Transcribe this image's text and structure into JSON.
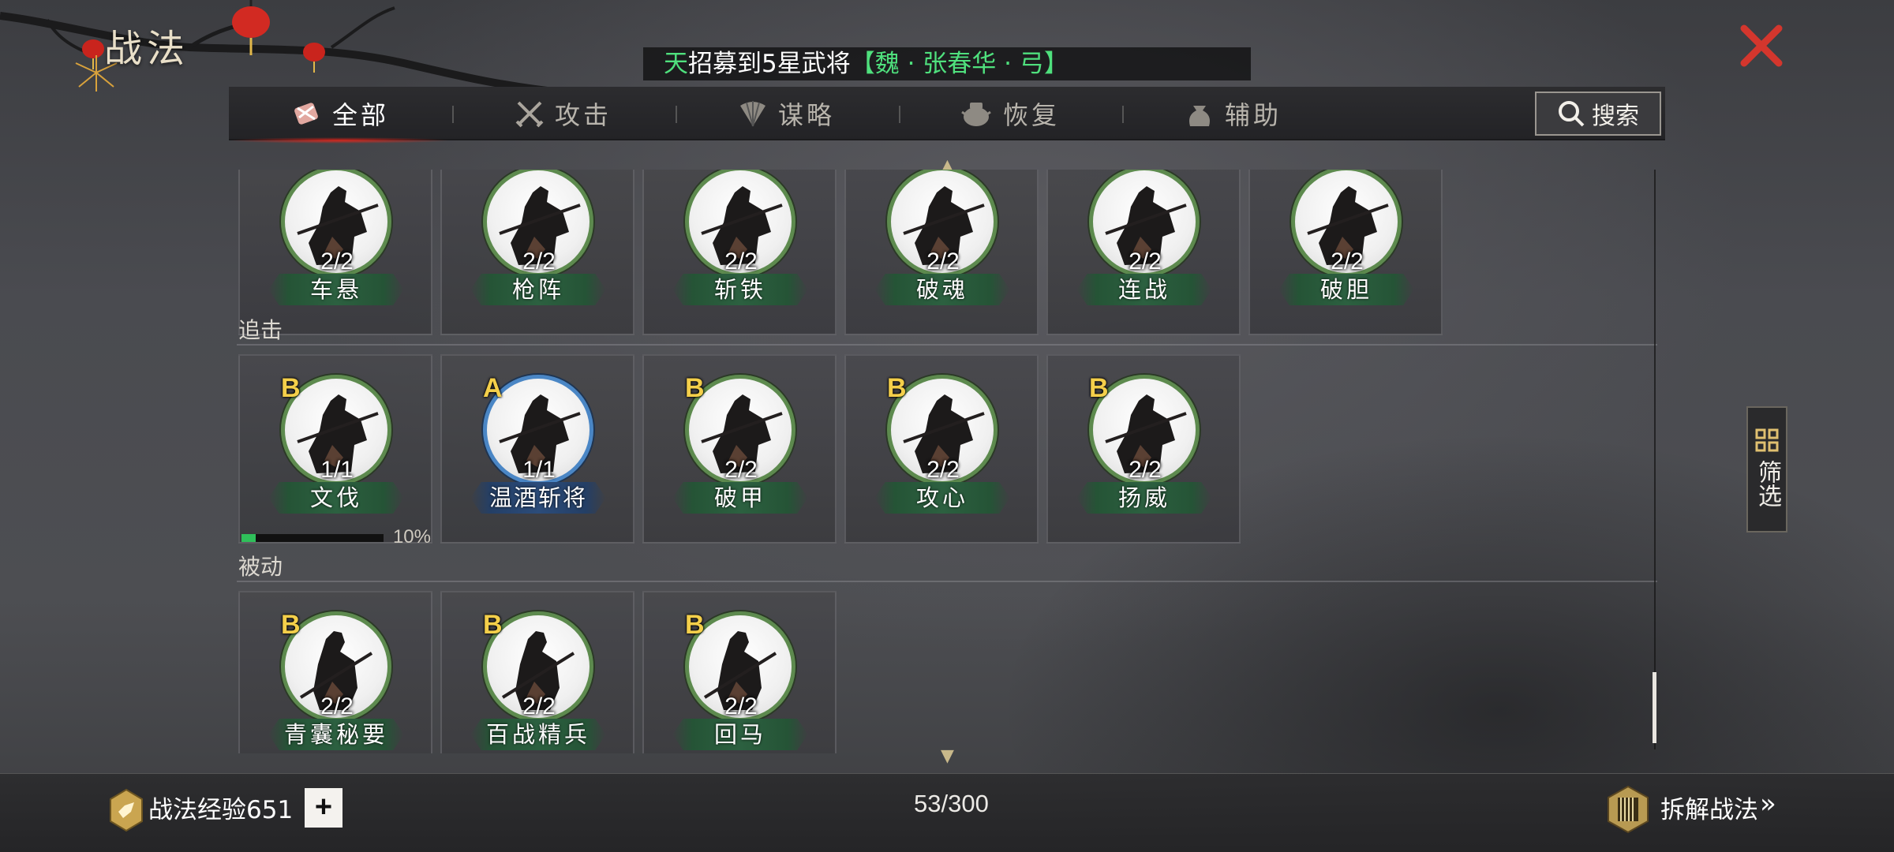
{
  "header": {
    "title": "战法",
    "close_icon": "close-icon",
    "ticker": {
      "part1": "天",
      "part2": "招募到5星武将",
      "part3": "【魏 · 张春华 · 弓】"
    }
  },
  "tabs": [
    {
      "label": "全部",
      "icon": "all-bundle-icon",
      "active": true
    },
    {
      "label": "攻击",
      "icon": "crossed-swords-icon",
      "active": false
    },
    {
      "label": "谋略",
      "icon": "strategy-fan-icon",
      "active": false
    },
    {
      "label": "恢复",
      "icon": "recover-pot-icon",
      "active": false
    },
    {
      "label": "辅助",
      "icon": "support-bag-icon",
      "active": false
    }
  ],
  "search": {
    "label": "搜索",
    "icon": "search-icon"
  },
  "filter": {
    "label": "筛选",
    "icon": "grid-icon"
  },
  "sections": [
    {
      "label": "",
      "cards": [
        {
          "name": "车悬",
          "count": "2/2",
          "grade": "",
          "color": "green"
        },
        {
          "name": "枪阵",
          "count": "2/2",
          "grade": "",
          "color": "green"
        },
        {
          "name": "斩铁",
          "count": "2/2",
          "grade": "",
          "color": "green"
        },
        {
          "name": "破魂",
          "count": "2/2",
          "grade": "",
          "color": "green"
        },
        {
          "name": "连战",
          "count": "2/2",
          "grade": "",
          "color": "green"
        },
        {
          "name": "破胆",
          "count": "2/2",
          "grade": "",
          "color": "green"
        }
      ]
    },
    {
      "label": "追击",
      "cards": [
        {
          "name": "文伐",
          "count": "1/1",
          "grade": "B",
          "color": "green",
          "progress": 0.1,
          "progress_label": "10%"
        },
        {
          "name": "温酒斩将",
          "count": "1/1",
          "grade": "A",
          "color": "blue"
        },
        {
          "name": "破甲",
          "count": "2/2",
          "grade": "B",
          "color": "green"
        },
        {
          "name": "攻心",
          "count": "2/2",
          "grade": "B",
          "color": "green"
        },
        {
          "name": "扬威",
          "count": "2/2",
          "grade": "B",
          "color": "green"
        }
      ]
    },
    {
      "label": "被动",
      "cards": [
        {
          "name": "青囊秘要",
          "count": "2/2",
          "grade": "B",
          "color": "green"
        },
        {
          "name": "百战精兵",
          "count": "2/2",
          "grade": "B",
          "color": "green"
        },
        {
          "name": "回马",
          "count": "2/2",
          "grade": "B",
          "color": "green"
        }
      ]
    }
  ],
  "footer": {
    "exp_label": "战法经验651",
    "plus_label": "+",
    "count": "53/300",
    "disassemble_label": "拆解战法",
    "disassemble_arrow": "»"
  },
  "colors": {
    "green_ring": "#5d8a4e",
    "blue_ring": "#4a86c5",
    "grade_gold": "#f4cf4a",
    "accent_red": "#c8302a"
  }
}
